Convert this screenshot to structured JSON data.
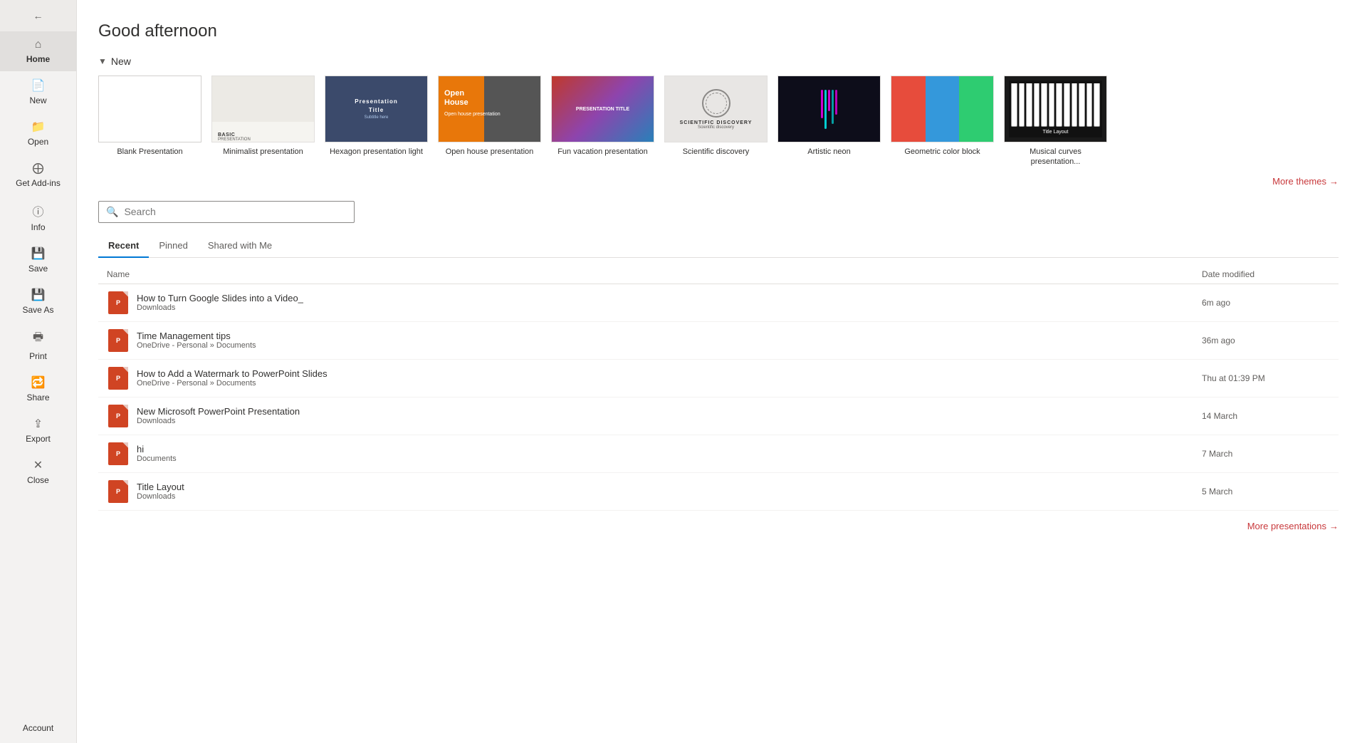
{
  "greeting": "Good afternoon",
  "sidebar": {
    "back_label": "←",
    "items": [
      {
        "id": "home",
        "label": "Home",
        "icon": "🏠",
        "active": true
      },
      {
        "id": "new",
        "label": "New",
        "icon": "📄"
      },
      {
        "id": "open",
        "label": "Open",
        "icon": "📂"
      },
      {
        "id": "get-addins",
        "label": "Get Add-ins",
        "icon": "⊞"
      },
      {
        "id": "info",
        "label": "Info",
        "icon": ""
      },
      {
        "id": "save",
        "label": "Save",
        "icon": ""
      },
      {
        "id": "save-as",
        "label": "Save As",
        "icon": ""
      },
      {
        "id": "print",
        "label": "Print",
        "icon": ""
      },
      {
        "id": "share",
        "label": "Share",
        "icon": ""
      },
      {
        "id": "export",
        "label": "Export",
        "icon": ""
      },
      {
        "id": "close",
        "label": "Close",
        "icon": ""
      }
    ],
    "account_label": "Account"
  },
  "new_section": {
    "header": "New",
    "collapsed": false
  },
  "templates": [
    {
      "id": "blank",
      "label": "Blank Presentation",
      "type": "blank"
    },
    {
      "id": "minimalist",
      "label": "Minimalist presentation",
      "type": "minimalist"
    },
    {
      "id": "hexagon",
      "label": "Hexagon presentation light",
      "type": "hexagon"
    },
    {
      "id": "openhouse",
      "label": "Open house presentation",
      "type": "openhouse"
    },
    {
      "id": "funvacation",
      "label": "Fun vacation presentation",
      "type": "funvacation"
    },
    {
      "id": "scientific",
      "label": "Scientific discovery",
      "type": "scientific"
    },
    {
      "id": "artisticneon",
      "label": "Artistic neon",
      "type": "artisticneon"
    },
    {
      "id": "geometric",
      "label": "Geometric color block",
      "type": "geometric"
    },
    {
      "id": "musical",
      "label": "Musical curves presentation...",
      "type": "musical"
    }
  ],
  "more_themes_label": "More themes",
  "search": {
    "placeholder": "Search",
    "value": ""
  },
  "tabs": [
    {
      "id": "recent",
      "label": "Recent",
      "active": true
    },
    {
      "id": "pinned",
      "label": "Pinned",
      "active": false
    },
    {
      "id": "shared",
      "label": "Shared with Me",
      "active": false
    }
  ],
  "file_list": {
    "col_name": "Name",
    "col_date": "Date modified",
    "files": [
      {
        "id": 1,
        "name": "How to Turn Google Slides into a Video_",
        "location": "Downloads",
        "date": "6m ago"
      },
      {
        "id": 2,
        "name": "Time Management tips",
        "location": "OneDrive - Personal » Documents",
        "date": "36m ago"
      },
      {
        "id": 3,
        "name": "How to Add a Watermark to PowerPoint Slides",
        "location": "OneDrive - Personal » Documents",
        "date": "Thu at 01:39 PM"
      },
      {
        "id": 4,
        "name": "New Microsoft PowerPoint Presentation",
        "location": "Downloads",
        "date": "14 March"
      },
      {
        "id": 5,
        "name": "hi",
        "location": "Documents",
        "date": "7 March"
      },
      {
        "id": 6,
        "name": "Title Layout",
        "location": "Downloads",
        "date": "5 March"
      }
    ]
  },
  "more_presentations_label": "More presentations"
}
